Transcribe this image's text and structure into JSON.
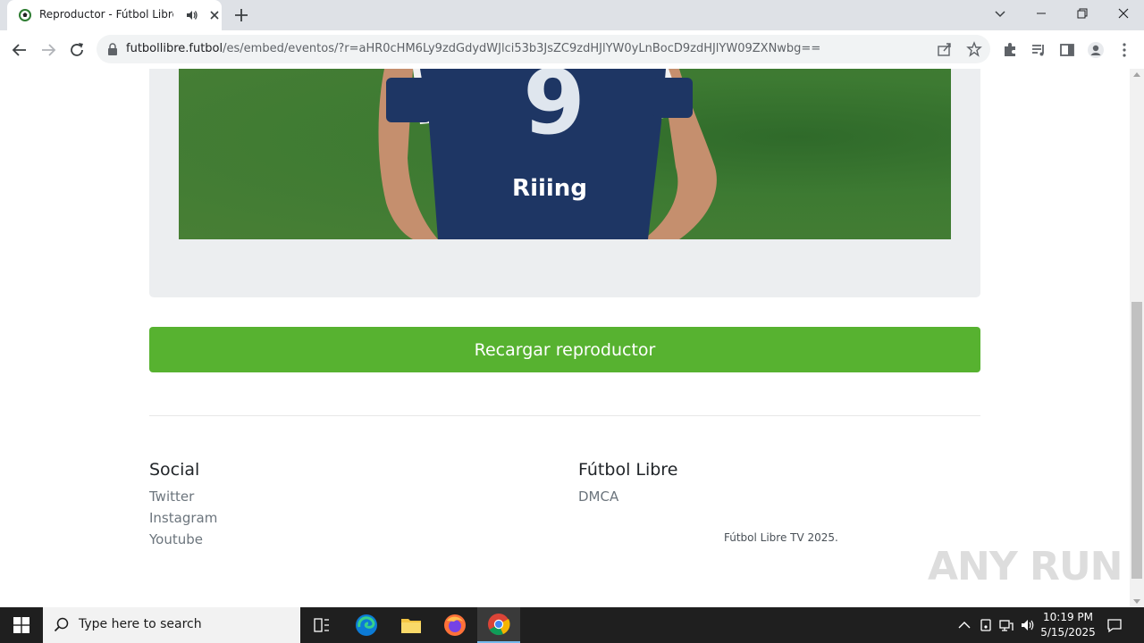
{
  "browser": {
    "tab": {
      "title": "Reproductor - Fútbol Libre TV",
      "favicon": "soccer-ball-icon"
    },
    "address": {
      "domain": "futbollibre.futbol",
      "path": "/es/embed/eventos/?r=aHR0cHM6Ly9zdGdydWJlci53b3JsZC9zdHJlYW0yLnBocD9zdHJlYW09ZXNwbg=="
    }
  },
  "page": {
    "player": {
      "reload_label": "Recargar reproductor",
      "jersey_number": "9",
      "sponsor": "Riiing"
    },
    "footer": {
      "social_heading": "Social",
      "social_links": [
        "Twitter",
        "Instagram",
        "Youtube"
      ],
      "brand_heading": "Fútbol Libre",
      "brand_links": [
        "DMCA"
      ],
      "copyright": "Fútbol Libre TV 2025."
    },
    "watermark": "ANY RUN"
  },
  "taskbar": {
    "search_placeholder": "Type here to search",
    "time": "10:19 PM",
    "date": "5/15/2025"
  },
  "colors": {
    "accent": "#57b230",
    "taskbar": "#1f1f1f",
    "jersey": "#1e3664"
  }
}
